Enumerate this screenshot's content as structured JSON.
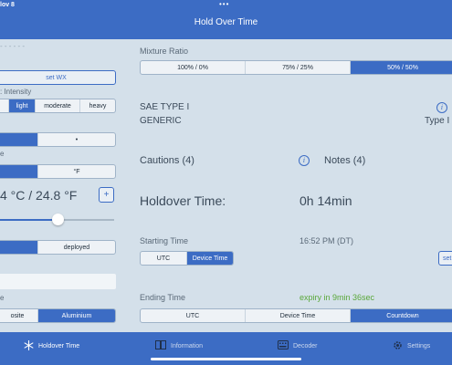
{
  "status": {
    "time": "lov 8",
    "dots": "•••"
  },
  "app": {
    "title": "Hold Over Time"
  },
  "left": {
    "dashes": "- - - - - -",
    "set_wx": "set WX",
    "precip_label": ": Intensity",
    "intensity": {
      "options": [
        "",
        "light",
        "moderate",
        "heavy"
      ],
      "selected": 1
    },
    "precip_seg": {
      "options": [
        "",
        "•"
      ],
      "selected": 0
    },
    "temp_label": "e",
    "unit_seg": {
      "options": [
        "",
        "°F"
      ],
      "selected": 0
    },
    "temp_value": "4 °C / 24.8 °F",
    "plus": "+",
    "slider_level": 0.5,
    "flap_seg": {
      "options": [
        "",
        "deployed"
      ],
      "selected": 0
    },
    "material_label": "e",
    "material_seg": {
      "options": [
        "osite",
        "Aluminium"
      ],
      "selected": 1
    }
  },
  "right": {
    "mixture_label": "Mixture Ratio",
    "mixture": {
      "options": [
        "100% / 0%",
        "75% / 25%",
        "50% / 50%"
      ],
      "selected": 2
    },
    "fluid_type": "SAE TYPE I",
    "fluid_name": "GENERIC",
    "type_right": "Type I",
    "cautions": "Cautions (4)",
    "notes": "Notes (4)",
    "holdover_label": "Holdover Time:",
    "holdover_value": "0h 14min",
    "starting_label": "Starting Time",
    "starting_value": "16:52 PM (DT)",
    "start_seg": {
      "options": [
        "UTC",
        "Device Time"
      ],
      "selected": 1
    },
    "set_btn": "set",
    "ending_label": "Ending Time",
    "expiry": "expiry in 9min 36sec",
    "end_seg": {
      "options": [
        "UTC",
        "Device Time",
        "Countdown"
      ],
      "selected": 2
    }
  },
  "tabs": [
    {
      "label": "Holdover Time",
      "icon": "snowflake-icon"
    },
    {
      "label": "Information",
      "icon": "book-icon"
    },
    {
      "label": "Decoder",
      "icon": "keyboard-icon"
    },
    {
      "label": "Settings",
      "icon": "gear-icon"
    }
  ],
  "colors": {
    "accent": "#3c6cc4",
    "background": "#d4e0ea",
    "expiry": "#5aa83a"
  }
}
